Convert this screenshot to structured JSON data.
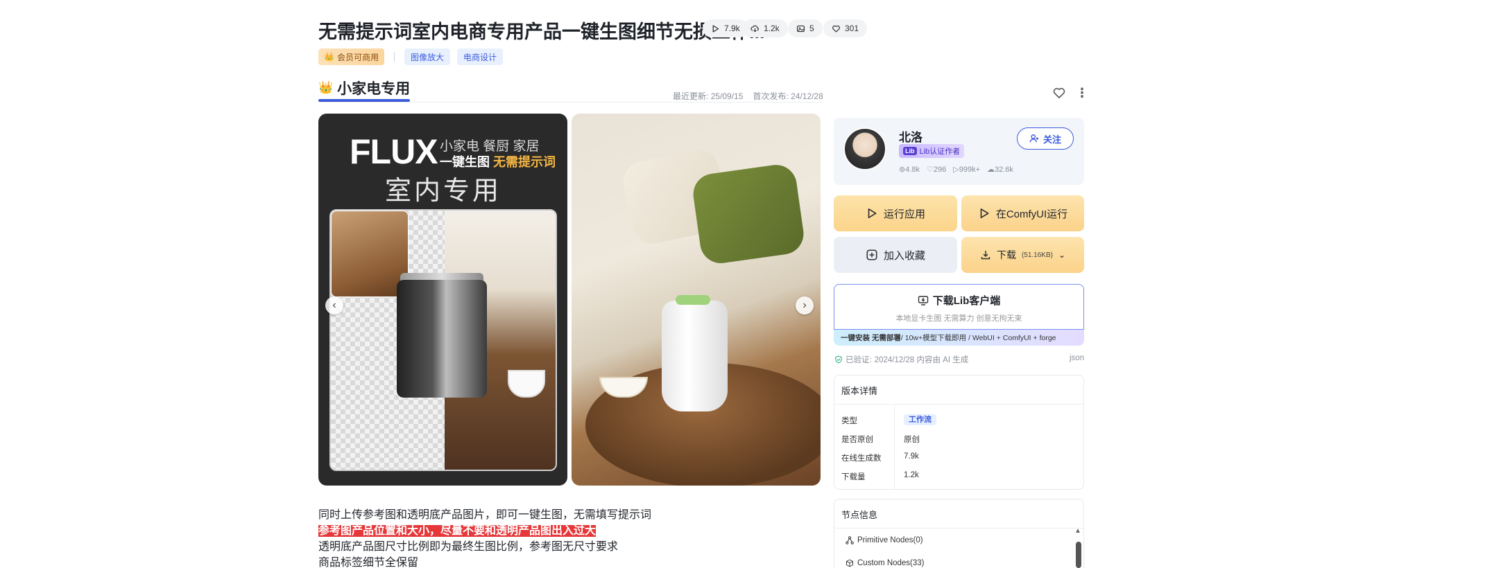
{
  "header": {
    "title": "无需提示词室内电商专用产品一键生图细节无损工作...",
    "stats": {
      "runs": "7.9k",
      "downloads": "1.2k",
      "images": "5",
      "likes": "301"
    }
  },
  "tags": {
    "vip": "会员可商用",
    "items": [
      "图像放大",
      "电商设计"
    ]
  },
  "section": {
    "title": "小家电专用",
    "updated_label": "最近更新:",
    "updated_value": "25/09/15",
    "published_label": "首次发布:",
    "published_value": "24/12/28"
  },
  "gallery": {
    "image1": {
      "logo": "FLUX",
      "line1": "小家电 餐厨 家居",
      "line2_prefix": "一键生图 ",
      "line2_highlight": "无需提示词",
      "big": "室内专用"
    },
    "prev_icon": "chevron-left-icon",
    "next_icon": "chevron-right-icon"
  },
  "description": {
    "line1": "同时上传参考图和透明底产品图片，即可一键生图，无需填写提示词",
    "line2": "参考图产品位置和大小，尽量不要和透明产品图出入过大",
    "line3": "透明底产品图尺寸比例即为最终生图比例，参考图无尺寸要求",
    "line4": "商品标签细节全保留"
  },
  "author": {
    "name": "北洛",
    "badge_logo": "Lib",
    "badge": "Lib认证作者",
    "stats": [
      "4.8k",
      "296",
      "999k+",
      "32.6k"
    ],
    "follow_label": "关注"
  },
  "actions": {
    "run_app": "运行应用",
    "run_comfyui": "在ComfyUI运行",
    "favorite": "加入收藏",
    "download": "下载",
    "download_size": "(51.16KB)"
  },
  "client": {
    "title": "下载Lib客户端",
    "subtitle": "本地显卡生图 无需算力 创意无拘无束",
    "bar_bold": "一键安装 无需部署",
    "bar_rest": " / 10w+模型下载即用 / WebUI + ComfyUI + forge"
  },
  "verification": {
    "label": "已验证:",
    "text": "2024/12/28 内容由 AI 生成",
    "json_link": "json"
  },
  "version_details": {
    "title": "版本详情",
    "rows": [
      {
        "key": "类型",
        "value": "工作流"
      },
      {
        "key": "是否原创",
        "value": "原创"
      },
      {
        "key": "在线生成数",
        "value": "7.9k"
      },
      {
        "key": "下载量",
        "value": "1.2k"
      }
    ]
  },
  "nodes": {
    "title": "节点信息",
    "items": [
      "Primitive Nodes(0)",
      "Custom Nodes(33)"
    ]
  },
  "colors": {
    "accent": "#3b5bdb",
    "gold": "#fbd48a",
    "red_highlight": "#e5383b"
  }
}
